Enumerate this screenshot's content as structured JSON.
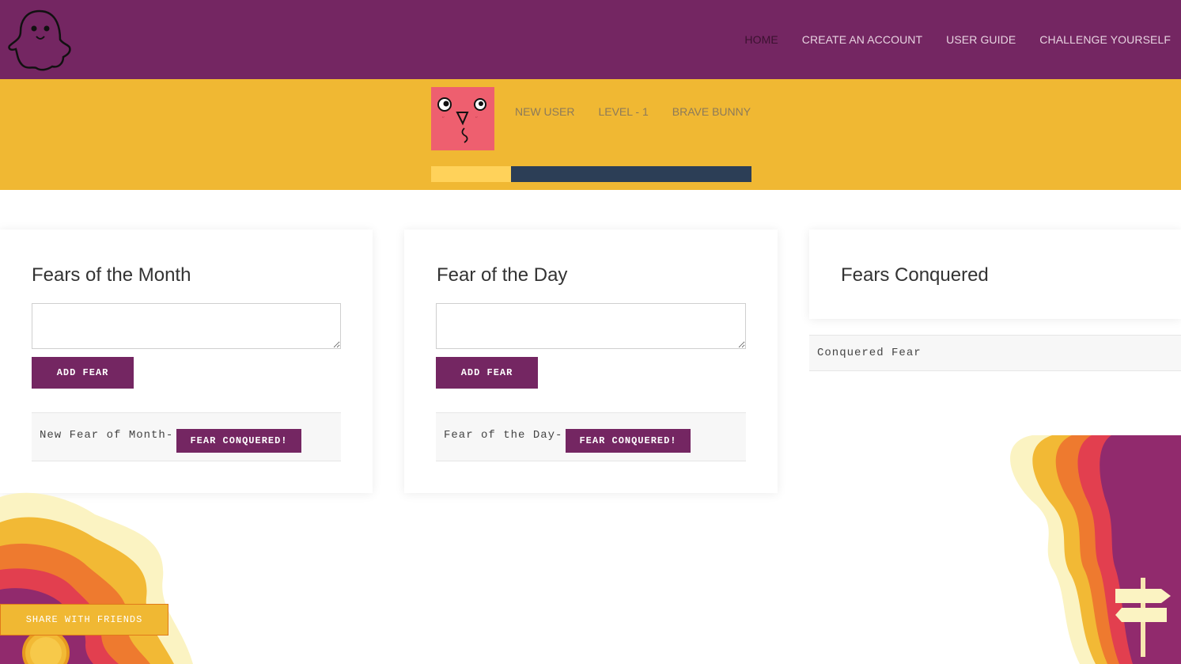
{
  "header": {
    "logo_icon": "ghost-icon",
    "nav": [
      {
        "label": "HOME",
        "active": true
      },
      {
        "label": "CREATE AN ACCOUNT",
        "active": false
      },
      {
        "label": "USER GUIDE",
        "active": false
      },
      {
        "label": "CHALLENGE YOURSELF",
        "active": false
      }
    ]
  },
  "profile": {
    "avatar_icon": "face-avatar-icon",
    "username": "NEW USER",
    "level": "LEVEL - 1",
    "rank": "BRAVE BUNNY",
    "progress_fraction": 0.25
  },
  "month_card": {
    "title": "Fears of the Month",
    "input_value": "",
    "add_label": "ADD FEAR",
    "items": [
      {
        "text": "New Fear of Month-",
        "button": "FEAR CONQUERED!"
      }
    ]
  },
  "day_card": {
    "title": "Fear of the Day",
    "input_value": "",
    "add_label": "ADD FEAR",
    "items": [
      {
        "text": "Fear of the Day-",
        "button": "FEAR CONQUERED!"
      }
    ]
  },
  "conquered_card": {
    "title": "Fears Conquered",
    "items": [
      "Conquered Fear"
    ]
  },
  "footer": {
    "share_label": "SHARE WITH FRIENDS"
  },
  "colors": {
    "brand_purple": "#742662",
    "brand_yellow": "#f0b833",
    "progress_track": "#2c3e56",
    "progress_fill": "#ffd25a",
    "avatar_bg": "#ee5f6f"
  }
}
